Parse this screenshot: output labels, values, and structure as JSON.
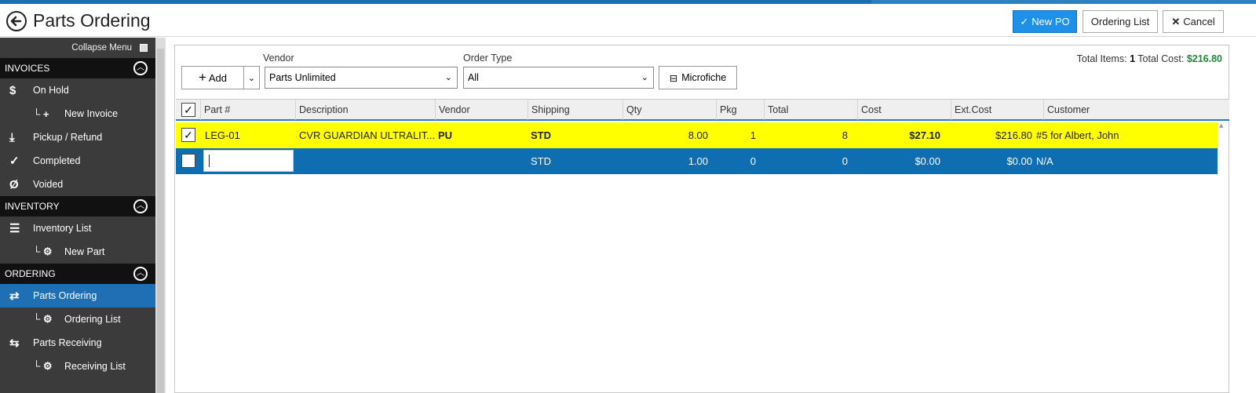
{
  "header": {
    "title": "Parts Ordering",
    "buttons": {
      "new_po": "New PO",
      "ordering_list": "Ordering List",
      "cancel": "Cancel"
    }
  },
  "sidebar": {
    "collapse_label": "Collapse Menu",
    "sections": [
      {
        "title": "INVOICES",
        "items": [
          {
            "label": "On Hold",
            "icon": "dollar-icon"
          },
          {
            "label": "New Invoice",
            "icon": "plus-icon",
            "sub": true
          },
          {
            "label": "Pickup / Refund",
            "icon": "refund-icon"
          },
          {
            "label": "Completed",
            "icon": "check-icon"
          },
          {
            "label": "Voided",
            "icon": "void-icon"
          }
        ]
      },
      {
        "title": "INVENTORY",
        "items": [
          {
            "label": "Inventory List",
            "icon": "list-icon"
          },
          {
            "label": "New Part",
            "icon": "gear-icon",
            "sub": true
          }
        ]
      },
      {
        "title": "ORDERING",
        "items": [
          {
            "label": "Parts Ordering",
            "icon": "order-icon",
            "active": true
          },
          {
            "label": "Ordering List",
            "icon": "gear-icon",
            "sub": true
          },
          {
            "label": "Parts Receiving",
            "icon": "receive-icon"
          },
          {
            "label": "Receiving List",
            "icon": "gear-icon",
            "sub": true
          }
        ]
      }
    ]
  },
  "toolbar": {
    "add_label": "Add",
    "vendor_label": "Vendor",
    "vendor_value": "Parts Unlimited",
    "order_type_label": "Order Type",
    "order_type_value": "All",
    "microfiche_label": "Microfiche"
  },
  "totals": {
    "items_label": "Total Items:",
    "items_value": "1",
    "cost_label": "Total Cost:",
    "cost_value": "$216.80"
  },
  "grid": {
    "columns": [
      "Part #",
      "Description",
      "Vendor",
      "Shipping",
      "Qty",
      "Pkg",
      "Total",
      "Cost",
      "Ext.Cost",
      "Customer"
    ],
    "rows": [
      {
        "part": "LEG-01",
        "description": "CVR GUARDIAN ULTRALIT...",
        "vendor": "PU",
        "shipping": "STD",
        "qty": "8.00",
        "pkg": "1",
        "total": "8",
        "cost": "$27.10",
        "ext_cost": "$216.80",
        "customer": "#5 for Albert, John"
      },
      {
        "part": "",
        "description": "",
        "vendor": "",
        "shipping": "STD",
        "qty": "1.00",
        "pkg": "0",
        "total": "0",
        "cost": "$0.00",
        "ext_cost": "$0.00",
        "customer": "N/A"
      }
    ]
  },
  "colors": {
    "accent": "#1e90e8",
    "selected_row": "#ffff00",
    "edit_row": "#0f6db1",
    "total_cost": "#1f8a3a",
    "sidebar_bg": "#3b3b3b"
  }
}
